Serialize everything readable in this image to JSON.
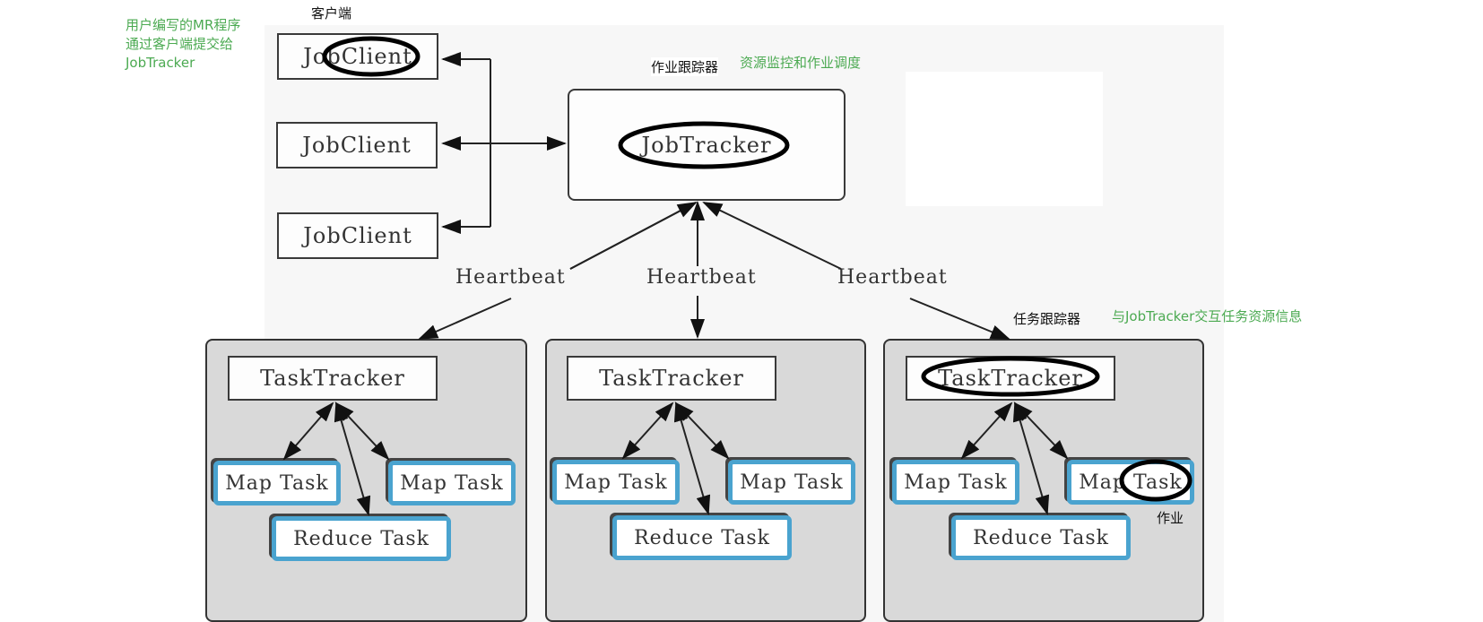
{
  "annotations": {
    "client_label": "客户端",
    "client_note_lines": [
      "用户编写的MR程序",
      "通过客户端提交给",
      "JobTracker"
    ],
    "jobtracker_label": "作业跟踪器",
    "jobtracker_note": "资源监控和作业调度",
    "tasktracker_label": "任务跟踪器",
    "tasktracker_note": "与JobTracker交互任务资源信息",
    "task_label": "作业"
  },
  "clients": [
    "JobClient",
    "JobClient",
    "JobClient"
  ],
  "jobtracker": "JobTracker",
  "heartbeats": [
    "Heartbeat",
    "Heartbeat",
    "Heartbeat"
  ],
  "nodes": [
    {
      "tasktracker": "TaskTracker",
      "map_tasks": [
        "Map Task",
        "Map Task"
      ],
      "reduce_task": "Reduce Task"
    },
    {
      "tasktracker": "TaskTracker",
      "map_tasks": [
        "Map Task",
        "Map Task"
      ],
      "reduce_task": "Reduce Task"
    },
    {
      "tasktracker": "TaskTracker",
      "map_tasks": [
        "Map Task",
        "Map Task"
      ],
      "reduce_task": "Reduce Task"
    }
  ],
  "colors": {
    "annotation_green": "#4caa52",
    "task_border_blue": "#4aa3cf",
    "node_fill": "#d9d9d9"
  }
}
